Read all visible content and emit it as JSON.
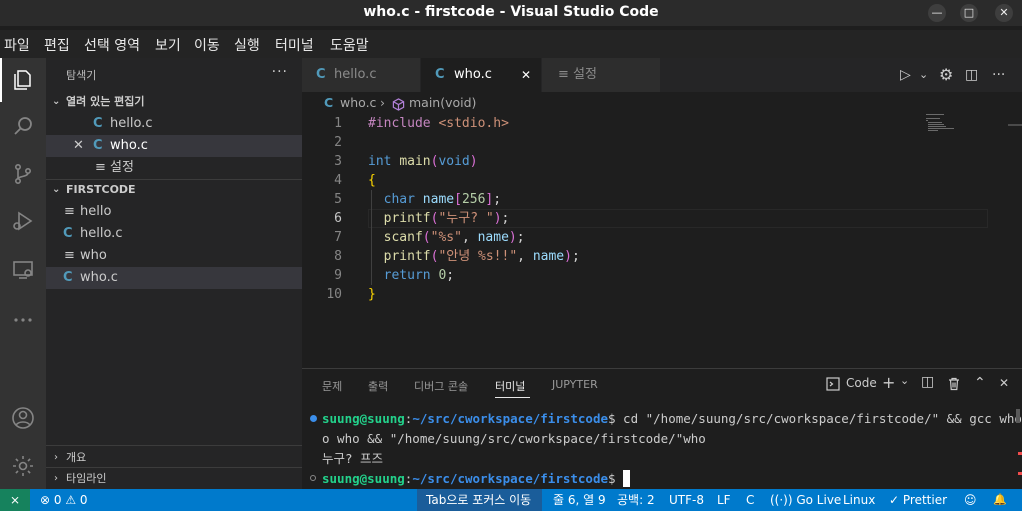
{
  "window": {
    "title": "who.c - firstcode - Visual Studio Code",
    "minimize_glyph": "—",
    "maximize_glyph": "□",
    "close_glyph": "✕"
  },
  "menu": [
    "파일",
    "편집",
    "선택 영역",
    "보기",
    "이동",
    "실행",
    "터미널",
    "도움말"
  ],
  "activity_bar": {
    "items": [
      "files-icon",
      "search-icon",
      "source-control-icon",
      "run-debug-icon",
      "remote-explorer-icon",
      "more-icon"
    ],
    "bottom": [
      "account-icon",
      "settings-gear-icon"
    ]
  },
  "sidebar": {
    "title": "탐색기",
    "more": "···",
    "open_editors": {
      "label": "열려 있는 편집기",
      "items": [
        {
          "icon": "C",
          "name": "hello.c"
        },
        {
          "icon": "C",
          "name": "who.c",
          "close": "✕"
        },
        {
          "icon": "≡",
          "name": "설정"
        }
      ]
    },
    "folder": {
      "label": "FIRSTCODE",
      "items": [
        {
          "icon": "≡",
          "name": "hello"
        },
        {
          "icon": "C",
          "name": "hello.c"
        },
        {
          "icon": "≡",
          "name": "who"
        },
        {
          "icon": "C",
          "name": "who.c"
        }
      ]
    },
    "outline": "개요",
    "timeline": "타임라인"
  },
  "tabs": [
    {
      "icon": "C",
      "name": "hello.c"
    },
    {
      "icon": "C",
      "name": "who.c",
      "close": "✕"
    },
    {
      "icon": "≡",
      "name": "설정"
    }
  ],
  "tab_actions": {
    "run": "▷",
    "run_dropdown": "⌄",
    "gear": "⚙",
    "split": "◫",
    "more": "···"
  },
  "breadcrumb": {
    "file_icon": "C",
    "file": "who.c",
    "sep": "›",
    "symbol": "main(void)"
  },
  "editor": {
    "line_numbers": [
      "1",
      "2",
      "3",
      "4",
      "5",
      "6",
      "7",
      "8",
      "9",
      "10"
    ],
    "current_line": 6,
    "lines": [
      "#include <stdio.h>",
      "",
      "int main(void)",
      "{",
      "  char name[256];",
      "  printf(\"누구? \");",
      "  scanf(\"%s\", name);",
      "  printf(\"안녕 %s!!\", name);",
      "  return 0;",
      "}"
    ]
  },
  "panel": {
    "tabs": [
      "문제",
      "출력",
      "디버그 콘솔",
      "터미널",
      "JUPYTER"
    ],
    "active_tab": "터미널",
    "terminal_name": "Code",
    "plus": "+",
    "chevron": "⌄",
    "split": "◫",
    "trash": "🗑",
    "maximize": "⌃",
    "close": "✕",
    "terminal": {
      "line1_user": "suung@suung",
      "line1_colon": ":",
      "line1_path": "~/src/cworkspace/firstcode",
      "line1_cmd": "$ cd \"/home/suung/src/cworkspace/firstcode/\" && gcc who.c -",
      "line2": "o who && \"/home/suung/src/cworkspace/firstcode/\"who",
      "line3": "누구? 프즈",
      "line4_user": "suung@suung",
      "line4_colon": ":",
      "line4_path": "~/src/cworkspace/firstcode",
      "line4_prompt": "$ "
    }
  },
  "statusbar": {
    "remote": "⨯",
    "errors": "⊗ 0 ⚠ 0",
    "focus_mode": "Tab으로 포커스 이동",
    "position": "줄 6, 열 9",
    "indent": "공백: 2",
    "encoding": "UTF-8",
    "eol": "LF",
    "language": "C",
    "golive": "((·)) Go Live",
    "platform": "Linux",
    "prettier": "✓ Prettier",
    "feedback": "☺",
    "bell": "🔔"
  },
  "colors": {
    "accent": "#007acc",
    "c_icon": "#519aba",
    "terminal_user": "#23d18b",
    "terminal_path": "#3b8eea"
  }
}
